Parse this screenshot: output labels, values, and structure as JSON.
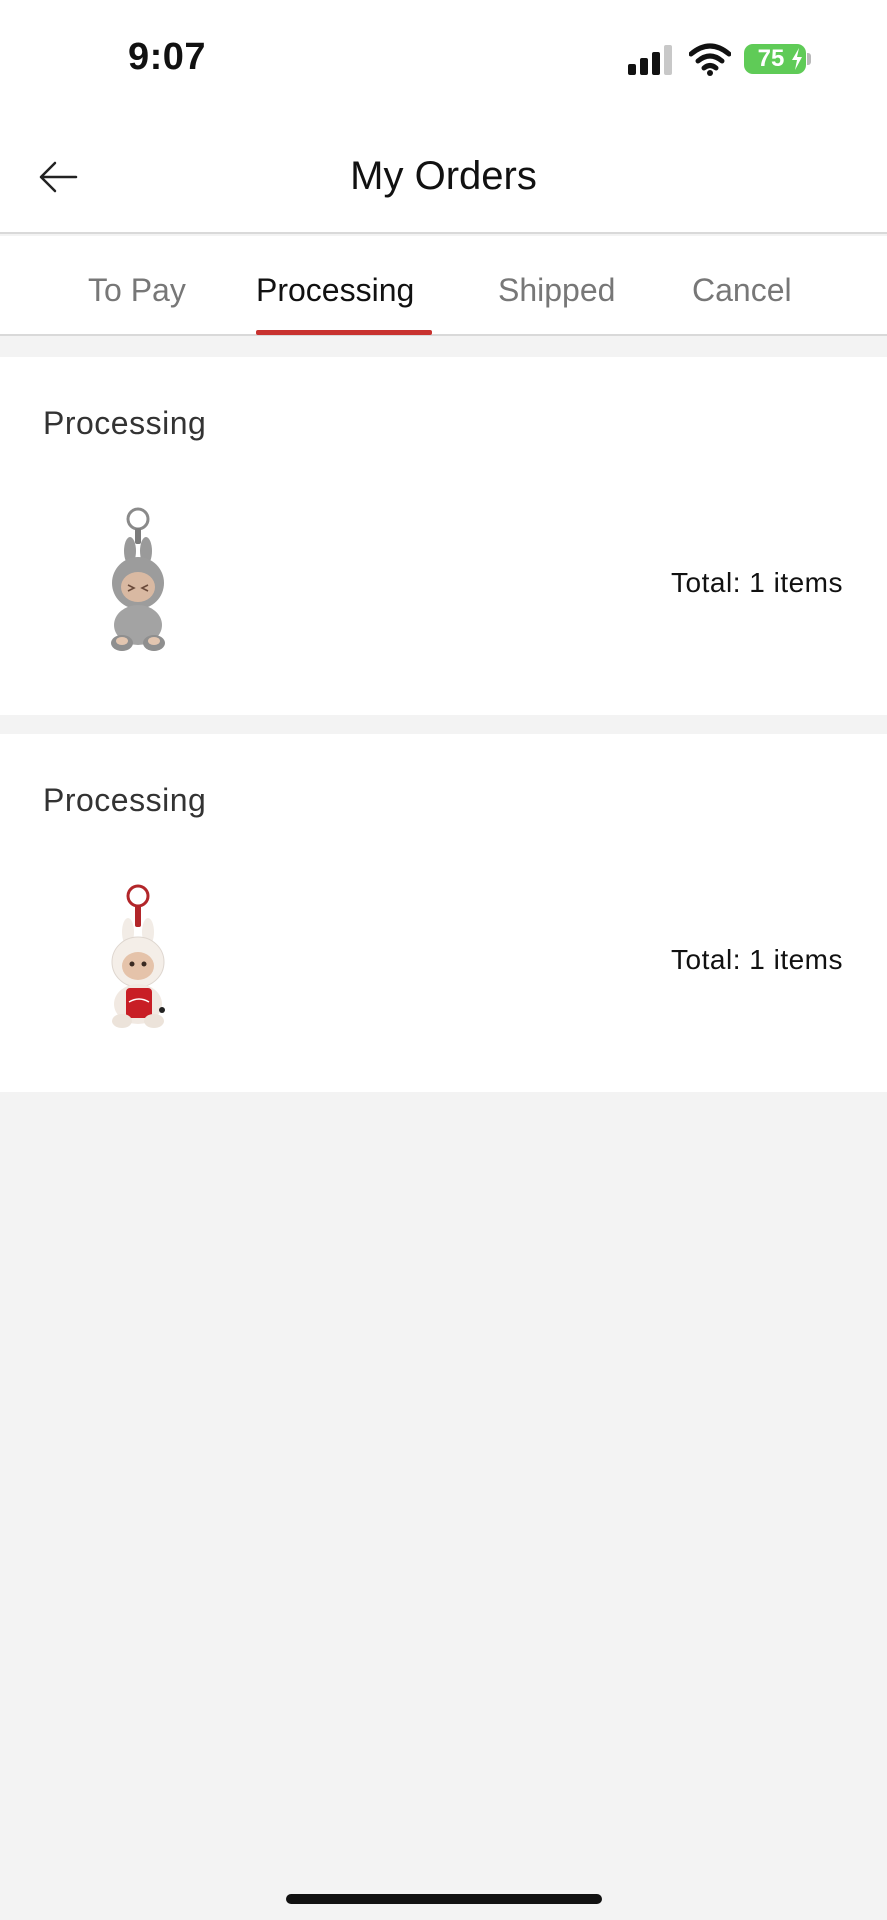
{
  "status_bar": {
    "time": "9:07",
    "battery": "75",
    "icons": [
      "cellular-signal-icon",
      "wifi-icon",
      "battery-charging-icon"
    ]
  },
  "header": {
    "title": "My Orders",
    "back_icon": "arrow-left-icon"
  },
  "tabs": [
    {
      "label": "To Pay",
      "active": false
    },
    {
      "label": "Processing",
      "active": true
    },
    {
      "label": "Shipped",
      "active": false
    },
    {
      "label": "Cancel",
      "active": false
    }
  ],
  "orders": [
    {
      "status": "Processing",
      "total": "Total: 1 items",
      "thumbnail": "grey-bunny-keychain-figure"
    },
    {
      "status": "Processing",
      "total": "Total: 1 items",
      "thumbnail": "white-bunny-keychain-with-red-can"
    }
  ],
  "colors": {
    "accent": "#c8322f",
    "battery": "#5fcb57",
    "background": "#f3f3f3"
  }
}
